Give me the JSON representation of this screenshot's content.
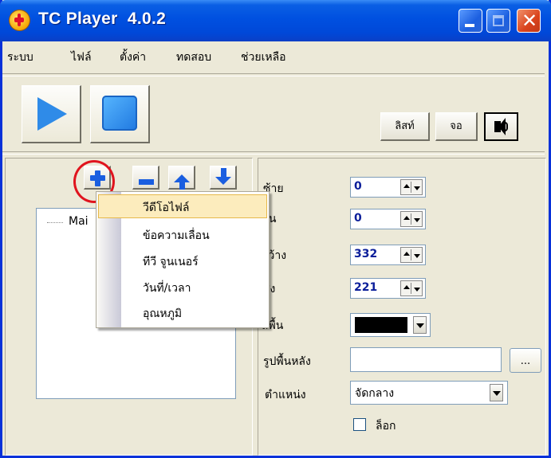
{
  "window": {
    "title": "TC Player  4.0.2"
  },
  "menubar": [
    "ระบบ",
    "ไฟล์",
    "ตั้งค่า",
    "ทดสอบ",
    "ช่วยเหลือ"
  ],
  "toolbar": {
    "list_label": "ลิสท์",
    "screen_label": "จอ"
  },
  "tree": {
    "root_label": "Mai"
  },
  "context_menu": {
    "items": [
      "วีดีโอไฟล์",
      "ข้อความเลื่อน",
      "ทีวี จูนเนอร์",
      "วันที่/เวลา",
      "อุณหภูมิ"
    ],
    "highlighted_index": 0
  },
  "properties": {
    "left_label": "ซ้าย",
    "left_value": "0",
    "top_label": "บน",
    "top_value": "0",
    "width_label": "กว้าง",
    "width_value": "332",
    "height_label": "สูง",
    "height_value": "221",
    "bg_color_label": "สีพื้น",
    "bg_color_value": "#000000",
    "bg_image_label": "รูปพื้นหลัง",
    "bg_image_value": "",
    "browse_label": "...",
    "position_label": "ตำแหน่ง",
    "position_value": "จัดกลาง",
    "lock_label": "ล็อก"
  }
}
